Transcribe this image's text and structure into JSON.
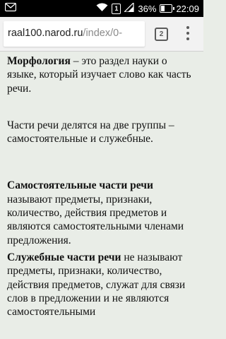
{
  "status_bar": {
    "time": "22:09",
    "battery_percent": "36%",
    "battery_level": 0.36,
    "sim_badge": "1",
    "icons": [
      "notification-icon",
      "wifi-icon",
      "sim-icon",
      "signal-icon",
      "battery-icon"
    ]
  },
  "browser": {
    "url_host": "raal100.narod.ru",
    "url_path": "/index/0-",
    "tab_count": "2"
  },
  "article": {
    "p1_term": "Морфология",
    "p1_text": " – это раздел науки о языке, который изучает слово как часть речи.",
    "p2_text": "Части речи делятся на две группы – самостоятельные и служебные.",
    "p3_term": "Самостоятельные части речи",
    "p3_text": " называют предметы, признаки, количество, действия предметов и являются самостоятельными членами предложения.",
    "p4_term": "Служебные части речи",
    "p4_text": " не называют предметы, признаки, количество, действия предметов, служат для связи слов в предложении и не являются самостоятельными"
  }
}
